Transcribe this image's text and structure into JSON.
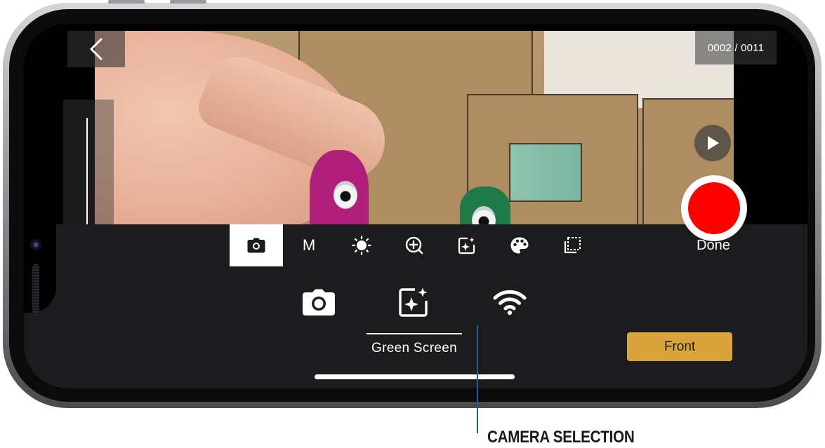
{
  "viewfinder": {
    "frame_counter": "0002 / 0011"
  },
  "toolbar": {
    "items": [
      {
        "name": "camera",
        "icon": "camera-icon",
        "active": true
      },
      {
        "name": "manual",
        "label": "M",
        "active": false
      },
      {
        "name": "exposure",
        "icon": "brightness-icon",
        "active": false
      },
      {
        "name": "add",
        "icon": "add-circle-icon",
        "active": false
      },
      {
        "name": "effects",
        "icon": "sparkle-frame-icon",
        "active": false
      },
      {
        "name": "color",
        "icon": "palette-icon",
        "active": false
      },
      {
        "name": "overlay",
        "icon": "frame-overlay-icon",
        "active": false
      }
    ],
    "done_label": "Done"
  },
  "camera_sources": {
    "options": [
      {
        "icon": "camera-icon"
      },
      {
        "icon": "sparkle-frame-icon"
      },
      {
        "icon": "wifi-icon"
      }
    ],
    "selected_label": "Green Screen",
    "front_label": "Front"
  },
  "callout": {
    "label": "CAMERA SELECTION"
  },
  "colors": {
    "record": "#ff0000",
    "accent_button": "#d9a43a",
    "panel": "#1c1c1e",
    "callout_line": "#1f5f95"
  }
}
